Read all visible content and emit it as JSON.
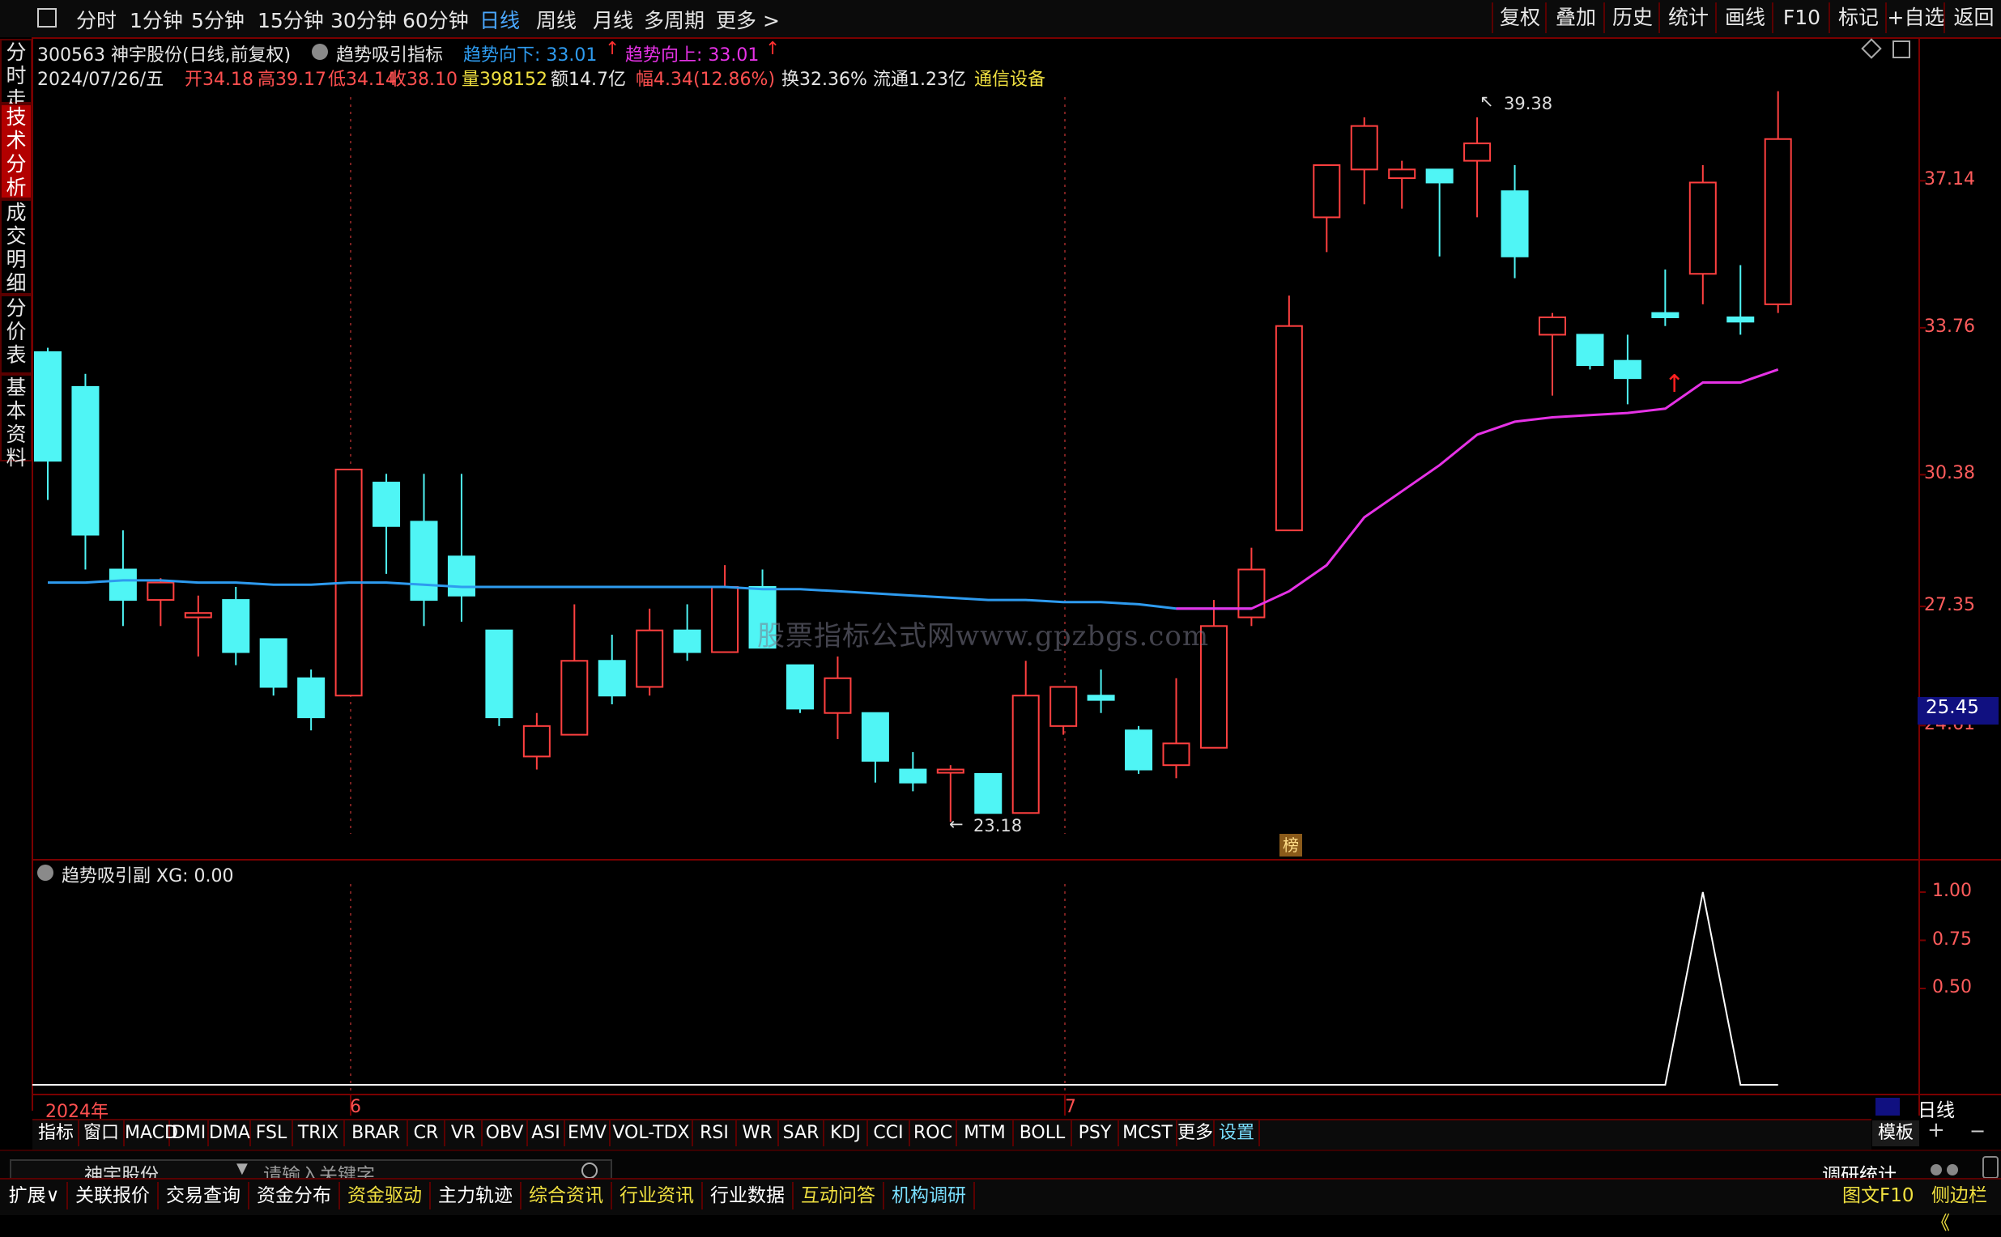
{
  "toolbar": {
    "periods": [
      "分时",
      "1分钟",
      "5分钟",
      "15分钟",
      "30分钟",
      "60分钟",
      "日线",
      "周线",
      "月线",
      "多周期",
      "更多 >"
    ],
    "active_period": "日线",
    "right_buttons": [
      "复权",
      "叠加",
      "历史",
      "统计",
      "画线",
      "F10",
      "标记",
      "+自选",
      "返回"
    ]
  },
  "sidebar": {
    "tabs": [
      "分时走势",
      "技术分析",
      "成交明细",
      "分价表",
      "基本资料"
    ],
    "active": "技术分析"
  },
  "header": {
    "code_name": "300563 神宇股份(日线,前复权)",
    "indicator_name": "趋势吸引指标",
    "trend_down": "趋势向下: 33.01",
    "trend_up": "趋势向上: 33.01",
    "date": "2024/07/26/五",
    "open": "开34.18",
    "high": "高39.17",
    "low": "低34.14",
    "close": "收38.10",
    "volume": "量398152",
    "amount": "额14.7亿",
    "change": "幅4.34(12.86%)",
    "turnover": "换32.36%",
    "float": "流通1.23亿",
    "sector": "通信设备"
  },
  "main_chart": {
    "price_labels": [
      "37.14",
      "33.76",
      "30.38",
      "27.35",
      "24.61"
    ],
    "current_price_tag": "25.45",
    "high_note": "39.38",
    "low_note": "23.18",
    "badge": "榜",
    "watermark": "股票指标公式网www.gpzbgs.com",
    "colors": {
      "up": "#ff4040",
      "down": "#4ff5f5",
      "ma1": "#2e9bef",
      "ma2": "#e632e6"
    }
  },
  "sub_chart": {
    "title": "趋势吸引副 XG: 0.00",
    "labels": [
      "1.00",
      "0.75",
      "0.50"
    ]
  },
  "chart_data": {
    "type": "candlestick",
    "x_labels": [
      "2024年",
      "6",
      "7"
    ],
    "candles": [
      {
        "o": 33.2,
        "h": 33.3,
        "l": 29.8,
        "c": 30.7
      },
      {
        "o": 32.4,
        "h": 32.7,
        "l": 28.2,
        "c": 29.0
      },
      {
        "o": 28.2,
        "h": 29.1,
        "l": 26.9,
        "c": 27.5
      },
      {
        "o": 27.5,
        "h": 28.0,
        "l": 26.9,
        "c": 27.9
      },
      {
        "o": 27.1,
        "h": 27.6,
        "l": 26.2,
        "c": 27.2
      },
      {
        "o": 27.5,
        "h": 27.8,
        "l": 26.0,
        "c": 26.3
      },
      {
        "o": 26.6,
        "h": 26.6,
        "l": 25.3,
        "c": 25.5
      },
      {
        "o": 25.7,
        "h": 25.9,
        "l": 24.5,
        "c": 24.8
      },
      {
        "o": 25.3,
        "h": 30.5,
        "l": 25.3,
        "c": 30.5
      },
      {
        "o": 30.2,
        "h": 30.4,
        "l": 28.1,
        "c": 29.2
      },
      {
        "o": 29.3,
        "h": 30.4,
        "l": 26.9,
        "c": 27.5
      },
      {
        "o": 28.5,
        "h": 30.4,
        "l": 27.0,
        "c": 27.6
      },
      {
        "o": 26.8,
        "h": 26.8,
        "l": 24.6,
        "c": 24.8
      },
      {
        "o": 23.9,
        "h": 24.9,
        "l": 23.6,
        "c": 24.6
      },
      {
        "o": 24.4,
        "h": 27.4,
        "l": 24.4,
        "c": 26.1
      },
      {
        "o": 26.1,
        "h": 26.7,
        "l": 25.1,
        "c": 25.3
      },
      {
        "o": 25.5,
        "h": 27.3,
        "l": 25.3,
        "c": 26.8
      },
      {
        "o": 26.8,
        "h": 27.4,
        "l": 26.1,
        "c": 26.3
      },
      {
        "o": 26.3,
        "h": 28.3,
        "l": 26.3,
        "c": 27.8
      },
      {
        "o": 27.8,
        "h": 28.2,
        "l": 26.4,
        "c": 26.4
      },
      {
        "o": 26.0,
        "h": 26.0,
        "l": 24.9,
        "c": 25.0
      },
      {
        "o": 24.9,
        "h": 26.2,
        "l": 24.3,
        "c": 25.7
      },
      {
        "o": 24.9,
        "h": 24.9,
        "l": 23.3,
        "c": 23.8
      },
      {
        "o": 23.6,
        "h": 24.0,
        "l": 23.1,
        "c": 23.3
      },
      {
        "o": 23.6,
        "h": 23.7,
        "l": 22.4,
        "c": 23.6
      },
      {
        "o": 23.5,
        "h": 23.5,
        "l": 22.6,
        "c": 22.6
      },
      {
        "o": 22.6,
        "h": 26.1,
        "l": 22.6,
        "c": 25.3
      },
      {
        "o": 24.6,
        "h": 25.5,
        "l": 24.4,
        "c": 25.5
      },
      {
        "o": 25.3,
        "h": 25.9,
        "l": 24.9,
        "c": 25.2
      },
      {
        "o": 24.5,
        "h": 24.6,
        "l": 23.5,
        "c": 23.6
      },
      {
        "o": 23.7,
        "h": 25.7,
        "l": 23.4,
        "c": 24.2
      },
      {
        "o": 24.1,
        "h": 27.5,
        "l": 24.1,
        "c": 26.9
      },
      {
        "o": 27.1,
        "h": 28.7,
        "l": 26.9,
        "c": 28.2
      },
      {
        "o": 29.1,
        "h": 34.5,
        "l": 29.1,
        "c": 33.8
      },
      {
        "o": 36.3,
        "h": 37.0,
        "l": 35.5,
        "c": 37.5
      },
      {
        "o": 37.4,
        "h": 38.6,
        "l": 36.6,
        "c": 38.4
      },
      {
        "o": 37.2,
        "h": 37.6,
        "l": 36.5,
        "c": 37.4
      },
      {
        "o": 37.4,
        "h": 37.4,
        "l": 35.4,
        "c": 37.1
      },
      {
        "o": 37.6,
        "h": 38.6,
        "l": 36.3,
        "c": 38.0
      },
      {
        "o": 36.9,
        "h": 37.5,
        "l": 34.9,
        "c": 35.4
      },
      {
        "o": 33.6,
        "h": 34.1,
        "l": 32.2,
        "c": 34.0
      },
      {
        "o": 33.6,
        "h": 33.6,
        "l": 32.8,
        "c": 32.9
      },
      {
        "o": 33.0,
        "h": 33.6,
        "l": 32.0,
        "c": 32.6
      },
      {
        "o": 34.1,
        "h": 35.1,
        "l": 33.8,
        "c": 34.0
      },
      {
        "o": 35.0,
        "h": 37.5,
        "l": 34.3,
        "c": 37.1
      },
      {
        "o": 34.0,
        "h": 35.2,
        "l": 33.6,
        "c": 33.9
      },
      {
        "o": 34.3,
        "h": 39.2,
        "l": 34.1,
        "c": 38.1
      }
    ],
    "ma_blue": [
      27.9,
      27.9,
      27.95,
      27.95,
      27.9,
      27.9,
      27.85,
      27.85,
      27.9,
      27.9,
      27.85,
      27.8,
      27.8,
      27.8,
      27.8,
      27.8,
      27.8,
      27.8,
      27.8,
      27.75,
      27.75,
      27.7,
      27.65,
      27.6,
      27.55,
      27.5,
      27.5,
      27.45,
      27.45,
      27.4,
      27.3,
      27.3,
      27.3
    ],
    "ma_pink": [
      null,
      null,
      null,
      null,
      null,
      null,
      null,
      null,
      null,
      null,
      null,
      null,
      null,
      null,
      null,
      null,
      null,
      null,
      null,
      null,
      null,
      null,
      null,
      null,
      null,
      null,
      null,
      null,
      null,
      null,
      27.3,
      27.3,
      27.3,
      27.7,
      28.3,
      29.4,
      30.0,
      30.6,
      31.3,
      31.6,
      31.7,
      31.75,
      31.8,
      31.9,
      32.5,
      32.5,
      32.8
    ],
    "sub_values": [
      0,
      0,
      0,
      0,
      0,
      0,
      0,
      0,
      0,
      0,
      0,
      0,
      0,
      0,
      0,
      0,
      0,
      0,
      0,
      0,
      0,
      0,
      0,
      0,
      0,
      0,
      0,
      0,
      0,
      0,
      0,
      0,
      0,
      0,
      0,
      0,
      0,
      0,
      0,
      0,
      0,
      0,
      0,
      0,
      1,
      0,
      0
    ]
  },
  "indicator_tabs": [
    "指标",
    "窗口",
    "MACD",
    "DMI",
    "DMA",
    "FSL",
    "TRIX",
    "BRAR",
    "CR",
    "VR",
    "OBV",
    "ASI",
    "EMV",
    "VOL-TDX",
    "RSI",
    "WR",
    "SAR",
    "KDJ",
    "CCI",
    "ROC",
    "MTM",
    "BOLL",
    "PSY",
    "MCST",
    "更多",
    "设置"
  ],
  "template_btn": "模板",
  "period_label": "日线",
  "bottom": {
    "stock_name": "神宇股份",
    "search_placeholder": "请输入关键字",
    "research": "调研统计",
    "items": [
      "扩展∨",
      "关联报价",
      "交易查询",
      "资金分布",
      "资金驱动",
      "主力轨迹",
      "综合资讯",
      "行业资讯",
      "行业数据",
      "互动问答",
      "机构调研"
    ],
    "right_items": [
      "图文F10",
      "侧边栏《"
    ]
  }
}
